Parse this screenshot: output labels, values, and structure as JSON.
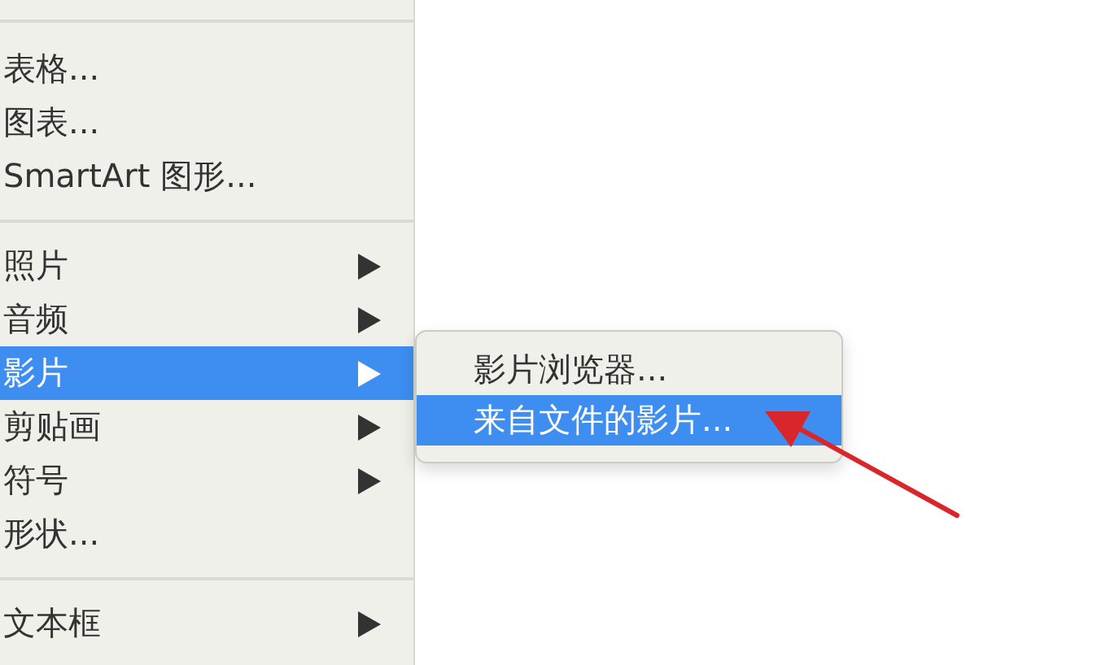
{
  "menu": {
    "items": [
      {
        "kind": "separator"
      },
      {
        "kind": "item",
        "label": "表格...",
        "submenu": false,
        "selected": false
      },
      {
        "kind": "item",
        "label": "图表...",
        "submenu": false,
        "selected": false
      },
      {
        "kind": "item",
        "label": "SmartArt 图形...",
        "submenu": false,
        "selected": false
      },
      {
        "kind": "separator"
      },
      {
        "kind": "item",
        "label": "照片",
        "submenu": true,
        "selected": false
      },
      {
        "kind": "item",
        "label": "音频",
        "submenu": true,
        "selected": false
      },
      {
        "kind": "item",
        "label": "影片",
        "submenu": true,
        "selected": true
      },
      {
        "kind": "item",
        "label": "剪贴画",
        "submenu": true,
        "selected": false
      },
      {
        "kind": "item",
        "label": "符号",
        "submenu": true,
        "selected": false
      },
      {
        "kind": "item",
        "label": "形状...",
        "submenu": false,
        "selected": false
      },
      {
        "kind": "separator"
      },
      {
        "kind": "item",
        "label": "文本框",
        "submenu": true,
        "selected": false
      }
    ]
  },
  "submenu": {
    "items": [
      {
        "label": "影片浏览器...",
        "selected": false
      },
      {
        "label": "来自文件的影片...",
        "selected": true
      }
    ]
  },
  "annotation": {
    "kind": "arrow"
  }
}
